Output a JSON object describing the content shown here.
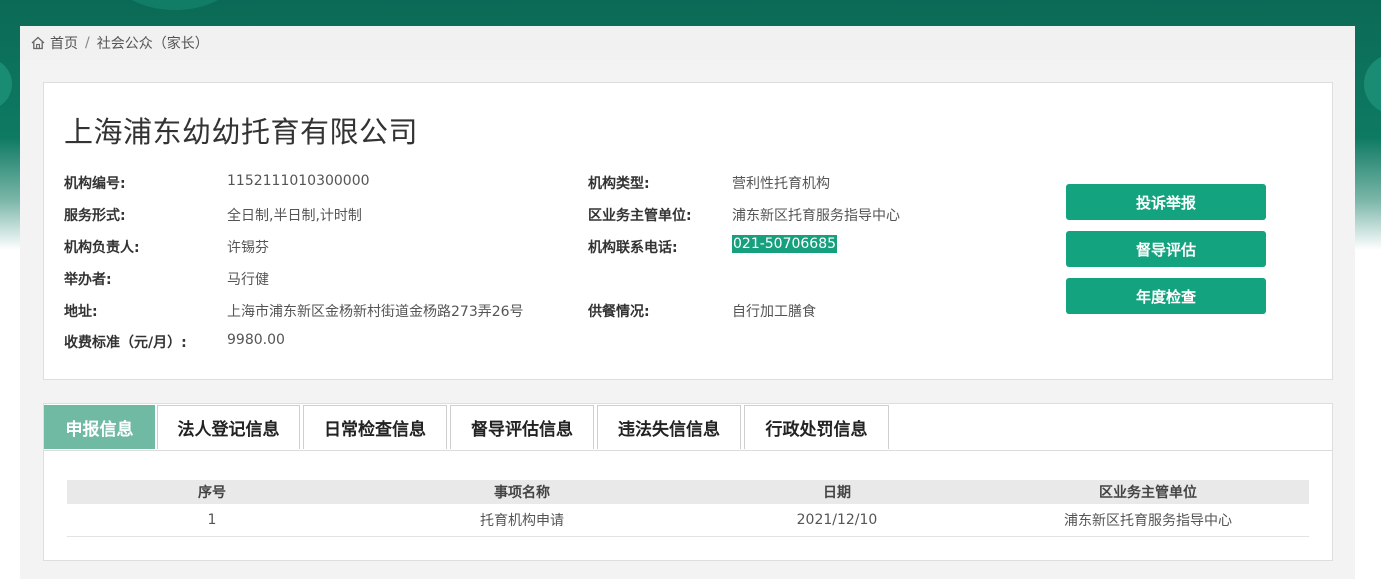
{
  "breadcrumb": {
    "home_icon": "home-icon",
    "home": "首页",
    "separator": "/",
    "current": "社会公众（家长）"
  },
  "org": {
    "name": "上海浦东幼幼托育有限公司",
    "fields": {
      "code_label": "机构编号:",
      "code": "1152111010300000",
      "type_label": "机构类型:",
      "type": "营利性托育机构",
      "service_label": "服务形式:",
      "service": "全日制,半日制,计时制",
      "authority_label": "区业务主管单位:",
      "authority": "浦东新区托育服务指导中心",
      "manager_label": "机构负责人:",
      "manager": "许锡芬",
      "phone_label": "机构联系电话:",
      "phone": "021-50706685",
      "organizer_label": "举办者:",
      "organizer": "马行健",
      "address_label": "地址:",
      "address": "上海市浦东新区金杨新村街道金杨路273弄26号",
      "catering_label": "供餐情况:",
      "catering": "自行加工膳食",
      "fee_label": "收费标准（元/月）:",
      "fee": "9980.00"
    },
    "actions": {
      "complaint": "投诉举报",
      "supervision": "督导评估",
      "annual": "年度检查"
    }
  },
  "tabs": [
    {
      "label": "申报信息",
      "active": true
    },
    {
      "label": "法人登记信息",
      "active": false
    },
    {
      "label": "日常检查信息",
      "active": false
    },
    {
      "label": "督导评估信息",
      "active": false
    },
    {
      "label": "违法失信信息",
      "active": false
    },
    {
      "label": "行政处罚信息",
      "active": false
    }
  ],
  "table": {
    "headers": [
      "序号",
      "事项名称",
      "日期",
      "区业务主管单位"
    ],
    "rows": [
      [
        "1",
        "托育机构申请",
        "2021/12/10",
        "浦东新区托育服务指导中心"
      ]
    ]
  },
  "colors": {
    "brand": "#13a37e",
    "tab_active": "#70b9a2",
    "header_band": "#0e7a62"
  }
}
